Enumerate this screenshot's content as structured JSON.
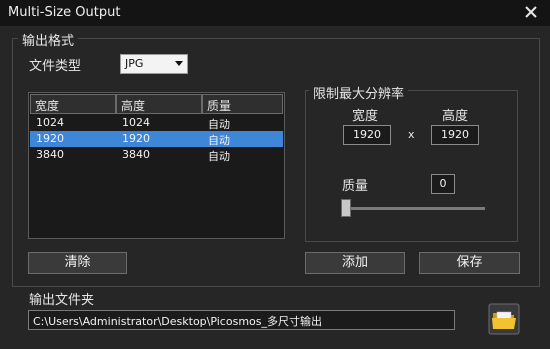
{
  "window": {
    "title": "Multi-Size Output"
  },
  "output_format": {
    "legend": "输出格式",
    "file_type_label": "文件类型",
    "file_type_value": "JPG"
  },
  "table": {
    "headers": [
      "宽度",
      "高度",
      "质量"
    ],
    "rows": [
      {
        "w": "1024",
        "h": "1024",
        "q": "自动",
        "selected": false
      },
      {
        "w": "1920",
        "h": "1920",
        "q": "自动",
        "selected": true
      },
      {
        "w": "3840",
        "h": "3840",
        "q": "自动",
        "selected": false
      }
    ]
  },
  "limit": {
    "legend": "限制最大分辨率",
    "width_label": "宽度",
    "height_label": "高度",
    "width_value": "1920",
    "x_symbol": "x",
    "height_value": "1920",
    "quality_label": "质量",
    "quality_value": "0",
    "quality_slider_fraction": 0
  },
  "buttons": {
    "clear": "清除",
    "add": "添加",
    "save": "保存"
  },
  "output_folder": {
    "label": "输出文件夹",
    "path": "C:\\Users\\Administrator\\Desktop\\Picosmos_多尺寸输出"
  }
}
